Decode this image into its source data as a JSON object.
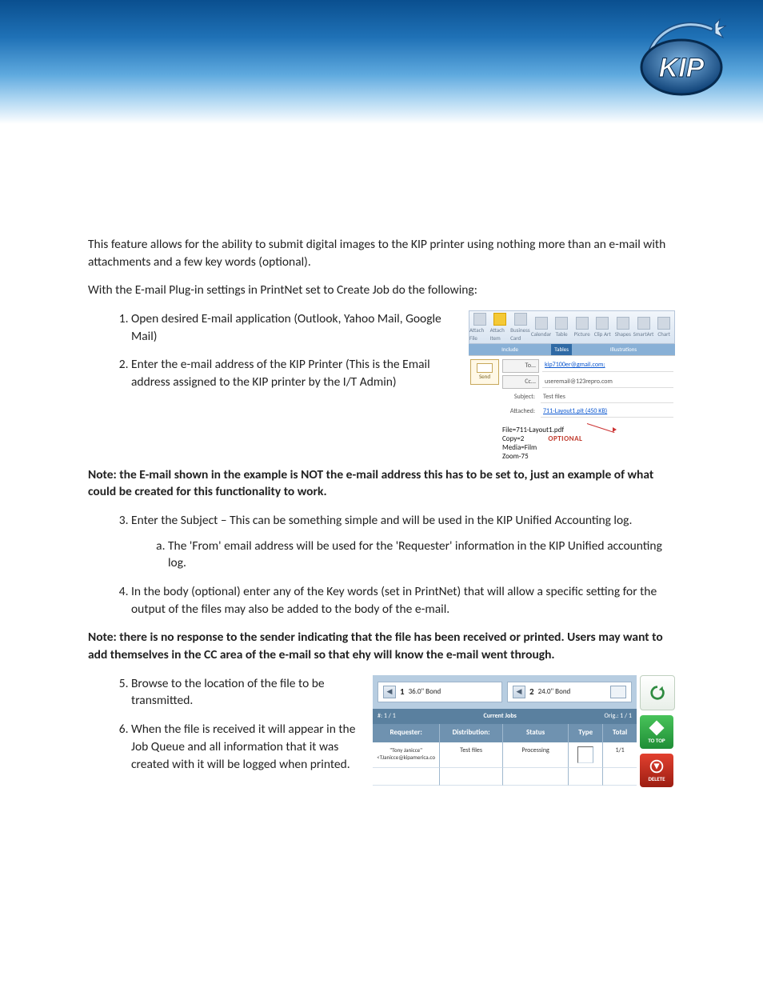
{
  "logo_text": "KIP",
  "intro1": "This feature allows for the ability to submit digital images to the KIP printer using nothing more than an e-mail with attachments and a few key words (optional).",
  "intro2": "With the E-mail Plug-in settings in PrintNet set to Create Job do the following:",
  "step1": "Open desired E-mail application (Outlook, Yahoo Mail, Google Mail)",
  "step2": "Enter the e-mail address of the KIP Printer (This is the Email address assigned to the KIP printer by the I/T Admin)",
  "note1": "Note: the E-mail shown in the example is NOT the e-mail address this has to be set to, just an example of what could be created for this functionality to work.",
  "step3": "Enter the Subject – This can be something simple and will be used in the KIP Unified Accounting log.",
  "step3a": "The 'From' email address will be used for the 'Requester' information in the KIP Unified accounting log.",
  "step4": "In the body (optional) enter any of the Key words (set in PrintNet) that will allow a specific setting for the output of the files may also be added to the body of the e-mail.",
  "note2": "Note: there is no response to the sender indicating that the file has been received or printed. Users may want to add themselves in the CC area of the e-mail so that ehy will know the e-mail went through.",
  "step5": "Browse to the location of the file to be transmitted.",
  "step6": "When the file is received it will appear in the Job Queue and all information that it was created with it will be logged when printed.",
  "ribbon": {
    "items": [
      "Attach File",
      "Attach Item",
      "Business Card",
      "Calendar",
      "Table",
      "Picture",
      "Clip Art",
      "Shapes",
      "SmartArt",
      "Chart"
    ],
    "groups": [
      "Include",
      "",
      "Tables",
      "Illustrations"
    ]
  },
  "email": {
    "send": "Send",
    "to_label": "To...",
    "to_val": "kip7100er@gmail.com;",
    "cc_label": "Cc...",
    "cc_val": "useremail@123repro.com",
    "subject_label": "Subject:",
    "subject_val": "Test files",
    "attached_label": "Attached:",
    "attached_val": "711-Layout1.plt (450 KB)",
    "body_lines": [
      "File=711-Layout1.pdf",
      "Copy=2",
      "Media=Film",
      "Zoom-75"
    ],
    "optional": "OPTIONAL"
  },
  "jobs": {
    "roll1_num": "1",
    "roll1_size": "36.0\" Bond",
    "roll2_num": "2",
    "roll2_size": "24.0\" Bond",
    "left_info": "#: 1 / 1",
    "title": "Current Jobs",
    "right_info": "Orig.: 1 / 1",
    "headers": [
      "Requester:",
      "Distribution:",
      "Status",
      "Type",
      "Total"
    ],
    "row": {
      "req": "\"Tony Janicce\" <TJanicce@kipamerica.co",
      "dist": "Test files",
      "status": "Processing",
      "type": "",
      "total": "1/1"
    },
    "btn_totop": "TO TOP",
    "btn_delete": "DELETE"
  }
}
